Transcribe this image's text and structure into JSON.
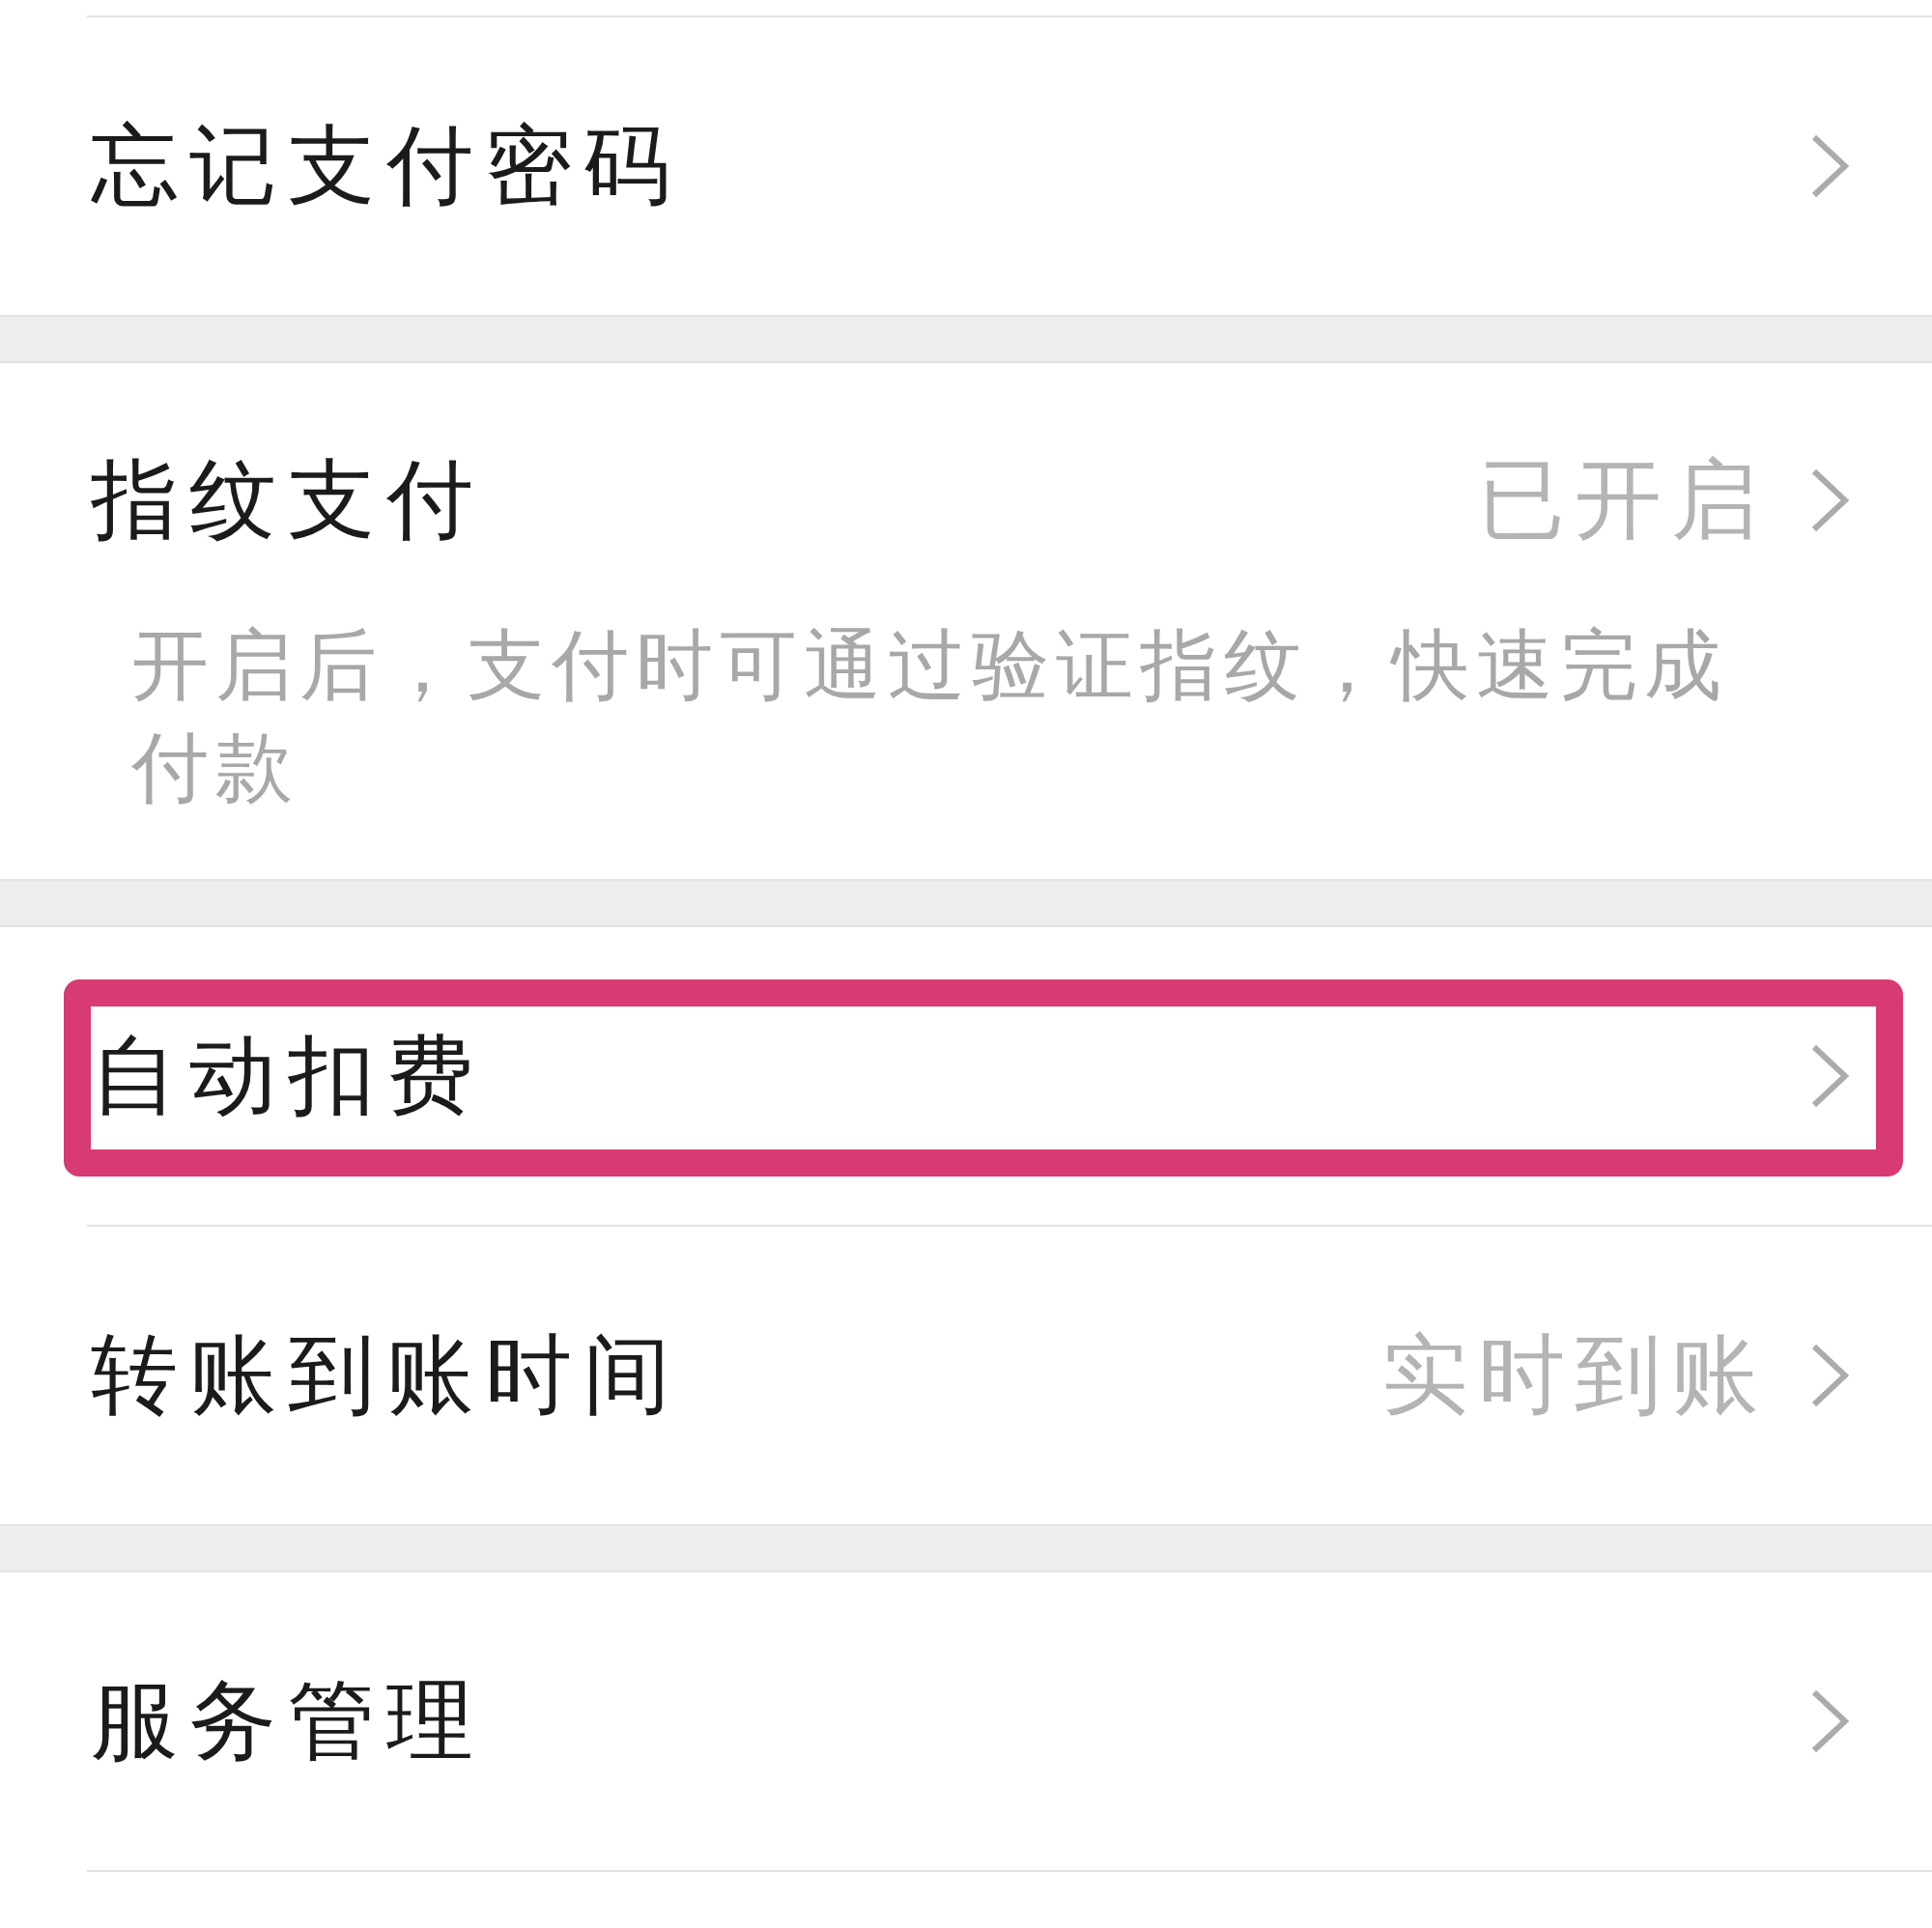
{
  "groups": [
    {
      "items": [
        {
          "label": "忘记支付密码",
          "highlighted": false
        }
      ]
    },
    {
      "items": [
        {
          "label": "指纹支付",
          "value": "已开启",
          "description": "开启后，支付时可通过验证指纹，快速完成付款",
          "highlighted": false
        }
      ]
    },
    {
      "items": [
        {
          "label": "自动扣费",
          "highlighted": true
        },
        {
          "label": "转账到账时间",
          "value": "实时到账",
          "highlighted": false
        }
      ]
    },
    {
      "items": [
        {
          "label": "服务管理",
          "highlighted": false
        }
      ]
    }
  ]
}
